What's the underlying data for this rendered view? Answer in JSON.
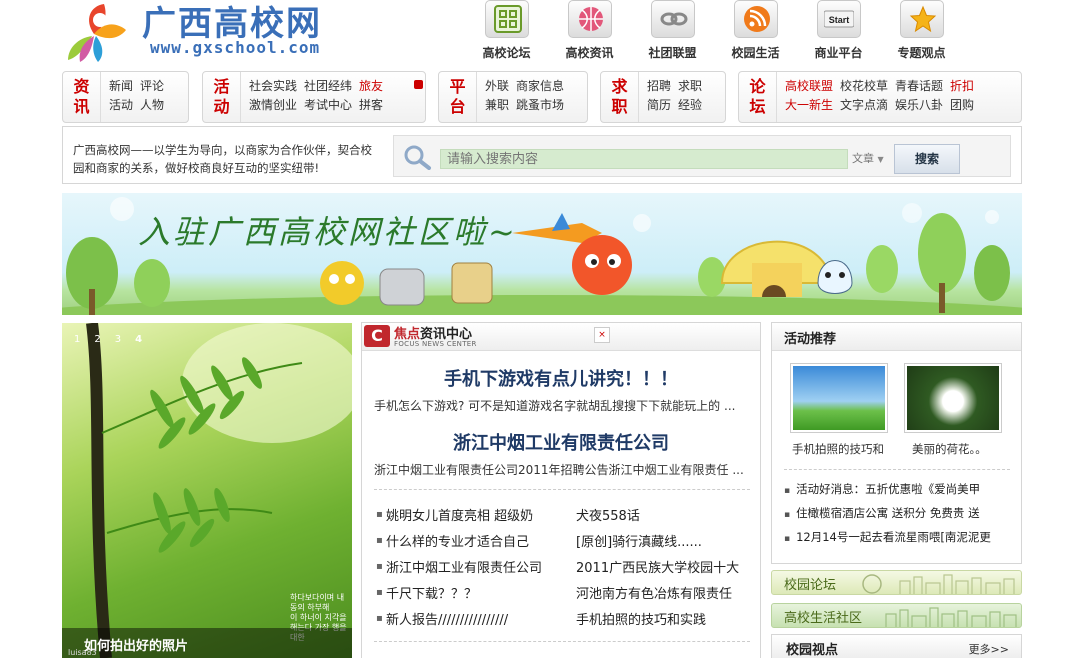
{
  "logo": {
    "title": "广西高校网",
    "url": "www.gxschool.com"
  },
  "topnav": [
    {
      "label": "高校论坛",
      "icon": "grid-icon"
    },
    {
      "label": "高校资讯",
      "icon": "basketball-icon"
    },
    {
      "label": "社团联盟",
      "icon": "link-icon"
    },
    {
      "label": "校园生活",
      "icon": "rss-icon"
    },
    {
      "label": "商业平台",
      "icon": "start-icon",
      "text": "Start"
    },
    {
      "label": "专题观点",
      "icon": "star-icon"
    }
  ],
  "categories": [
    {
      "head": [
        "资",
        "讯"
      ],
      "links": [
        "新闻",
        "评论",
        "活动",
        "人物"
      ]
    },
    {
      "head": [
        "活",
        "动"
      ],
      "links": [
        "社会实践",
        "社团经纬",
        "旅友",
        "激情创业",
        "考试中心",
        "拼客"
      ]
    },
    {
      "head": [
        "平",
        "台"
      ],
      "links": [
        "外联",
        "商家信息",
        "兼职",
        "跳蚤市场"
      ]
    },
    {
      "head": [
        "求",
        "职"
      ],
      "links": [
        "招聘",
        "求职",
        "简历",
        "经验"
      ]
    },
    {
      "head": [
        "论",
        "坛"
      ],
      "links": [
        "高校联盟",
        "校花校草",
        "青春话题",
        "折扣",
        "大一新生",
        "文字点滴",
        "娱乐八卦",
        "团购"
      ]
    }
  ],
  "intro": {
    "text": "广西高校网——以学生为导向，以商家为合作伙伴，契合校园和商家的关系，做好校商良好互动的坚实纽带!"
  },
  "search": {
    "placeholder": "请输入搜索内容",
    "type": "文章",
    "button": "搜索"
  },
  "banner": {
    "title": "入驻广西高校网社区啦~"
  },
  "slider": {
    "dots": [
      "1",
      "2",
      "3",
      "4"
    ],
    "caption": "如何拍出好的照片",
    "credit": "luisa83",
    "handwriting": [
      "하다보다이며 내 동의 하부해",
      "이 하너이 지각을 해는다 가장 행을 대한"
    ]
  },
  "news": {
    "brand_red": "焦点",
    "brand": "资讯中心",
    "brand_en": "FOCUS NEWS CENTER",
    "close": "×",
    "headline1": "手机下游戏有点儿讲究！！！",
    "summary1": "手机怎么下游戏? 可不是知道游戏名字就胡乱搜搜下下就能玩上的 ...",
    "headline2": "浙江中烟工业有限责任公司",
    "summary2": "浙江中烟工业有限责任公司2011年招聘公告浙江中烟工业有限责任 ...",
    "list": [
      {
        "left": "姚明女儿首度亮相 超级奶",
        "right": "犬夜558话"
      },
      {
        "left": "什么样的专业才适合自己",
        "right": "[原创]骑行滇藏线......"
      },
      {
        "left": "浙江中烟工业有限责任公司",
        "right": "2011广西民族大学校园十大"
      },
      {
        "left": "千尺下载？？？",
        "right": "河池南方有色冶炼有限责任"
      },
      {
        "left": "新人报告////////////////",
        "right": "手机拍照的技巧和实践"
      }
    ]
  },
  "activity": {
    "title": "活动推荐",
    "thumbs": [
      {
        "caption": "手机拍照的技巧和"
      },
      {
        "caption": "美丽的荷花。。"
      }
    ],
    "list": [
      "活动好消息：五折优惠啦《爱尚美甲",
      "住橄榄宿酒店公寓 送积分 免费贵 送",
      "12月14号一起去看流星雨喂[南泥泥更"
    ]
  },
  "forum_bar": {
    "label": "校园论坛"
  },
  "life_bar": {
    "label": "高校生活社区"
  },
  "views": {
    "title": "校园视点",
    "more": "更多>>"
  }
}
